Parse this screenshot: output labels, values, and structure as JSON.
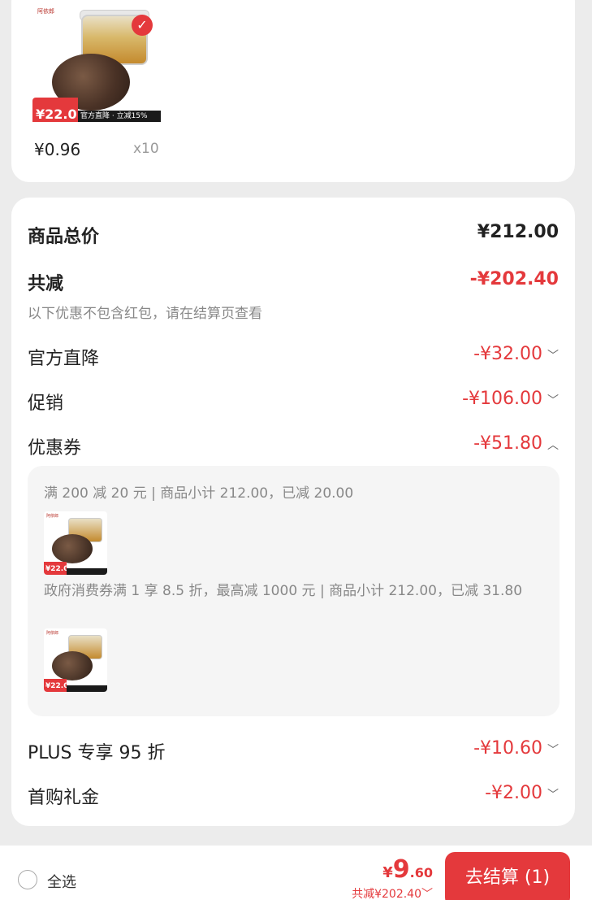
{
  "product": {
    "brand": "阿依郎",
    "price_tag": "¥22.0",
    "promo_strip": "官方直降 · 立减15%",
    "unit_price": "¥0.96",
    "quantity": "x10"
  },
  "summary": {
    "total_label": "商品总价",
    "total_value": "¥212.00",
    "reduce_label": "共减",
    "reduce_value": "-¥202.40",
    "note": "以下优惠不包含红包，请在结算页查看",
    "items": [
      {
        "label": "官方直降",
        "value": "-¥32.00",
        "arrow": "down"
      },
      {
        "label": "促销",
        "value": "-¥106.00",
        "arrow": "down"
      },
      {
        "label": "优惠券",
        "value": "-¥51.80",
        "arrow": "up"
      }
    ],
    "coupons": [
      {
        "text": "满 200 减 20 元 | 商品小计 212.00，已减 20.00",
        "thumb_tag": "¥22.0"
      },
      {
        "text": "政府消费券满 1 享 8.5 折，最高减 1000 元 | 商品小计 212.00，已减 31.80",
        "thumb_tag": "¥22.0"
      }
    ],
    "extra_items": [
      {
        "label": "PLUS 专享 95 折",
        "value": "-¥10.60",
        "arrow": "down"
      },
      {
        "label": "首购礼金",
        "value": "-¥2.00",
        "arrow": "down"
      }
    ]
  },
  "bottom": {
    "select_all": "全选",
    "price_yen": "¥",
    "price_int": "9",
    "price_dec": ".60",
    "saved": "共减¥202.40",
    "checkout": "去结算 (1)"
  },
  "colors": {
    "accent": "#e4393c"
  }
}
